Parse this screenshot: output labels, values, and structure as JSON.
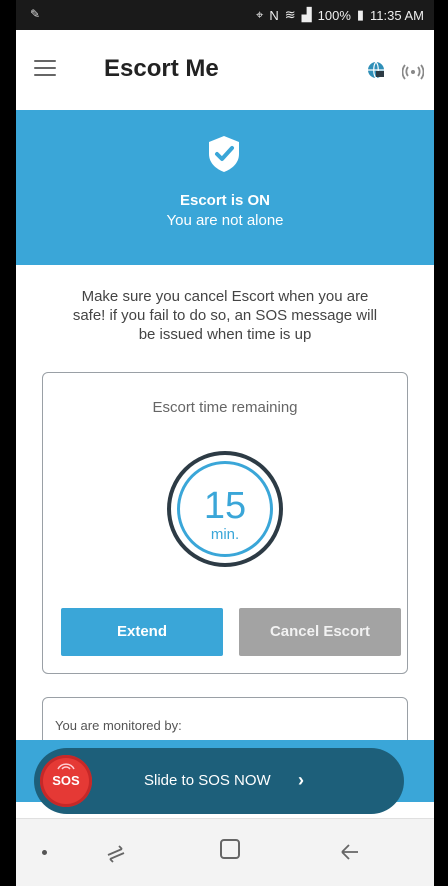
{
  "status_bar": {
    "battery": "100%",
    "time": "11:35 AM"
  },
  "app_bar": {
    "title": "Escort Me"
  },
  "banner": {
    "title": "Escort is ON",
    "subtitle": "You are not alone",
    "icon": "shield-check-icon"
  },
  "warning": {
    "text": "Make sure you cancel Escort when you are safe! if you fail to do so, an SOS message will be issued when time is up"
  },
  "escort_card": {
    "title": "Escort time remaining",
    "timer_value": "15",
    "timer_unit": "min.",
    "extend_label": "Extend",
    "cancel_label": "Cancel Escort"
  },
  "monitor_card": {
    "label": "You are monitored by:"
  },
  "sos": {
    "button_label": "SOS",
    "slide_text": "Slide to SOS NOW",
    "arrow": "›"
  },
  "colors": {
    "accent": "#3aa6d8",
    "sos_red": "#e53935",
    "cancel_gray": "#a3a3a3",
    "sos_pill": "#1d5f7a"
  }
}
